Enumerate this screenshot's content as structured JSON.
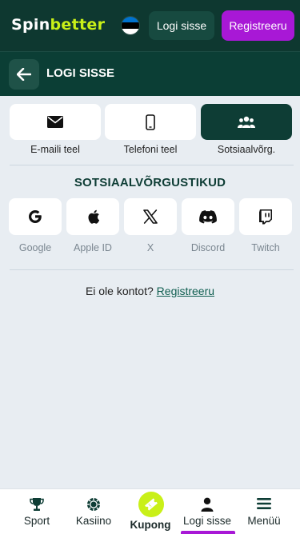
{
  "header": {
    "logo_part1": "Spin",
    "logo_part2": "better",
    "login_label": "Logi sisse",
    "register_label": "Registreeru",
    "flag_colors": [
      "#0072ce",
      "#000000",
      "#ffffff"
    ]
  },
  "subheader": {
    "title": "LOGI SISSE",
    "back_icon": "arrow-left-icon"
  },
  "tabs": [
    {
      "label": "E-maili teel",
      "icon": "envelope-icon",
      "active": false
    },
    {
      "label": "Telefoni teel",
      "icon": "phone-icon",
      "active": false
    },
    {
      "label": "Sotsiaalvõrg.",
      "icon": "users-icon",
      "active": true
    }
  ],
  "social": {
    "title": "SOTSIAALVÕRGUSTIKUD",
    "items": [
      {
        "label": "Google",
        "icon": "google-icon"
      },
      {
        "label": "Apple ID",
        "icon": "apple-icon"
      },
      {
        "label": "X",
        "icon": "x-icon"
      },
      {
        "label": "Discord",
        "icon": "discord-icon"
      },
      {
        "label": "Twitch",
        "icon": "twitch-icon"
      }
    ]
  },
  "footer_prompt": {
    "text": "Ei ole kontot?",
    "link": "Registreeru"
  },
  "bottom_nav": [
    {
      "label": "Sport",
      "icon": "trophy-icon"
    },
    {
      "label": "Kasiino",
      "icon": "casino-chip-icon"
    },
    {
      "label": "Kupong",
      "icon": "ticket-icon"
    },
    {
      "label": "Logi sisse",
      "icon": "user-icon",
      "active": true
    },
    {
      "label": "Menüü",
      "icon": "menu-icon"
    }
  ],
  "colors": {
    "header_bg": "#0e3830",
    "accent_green": "#c9f018",
    "accent_purple": "#a818d6",
    "active_tab": "#0e3d35",
    "page_bg": "#e8edf2"
  }
}
